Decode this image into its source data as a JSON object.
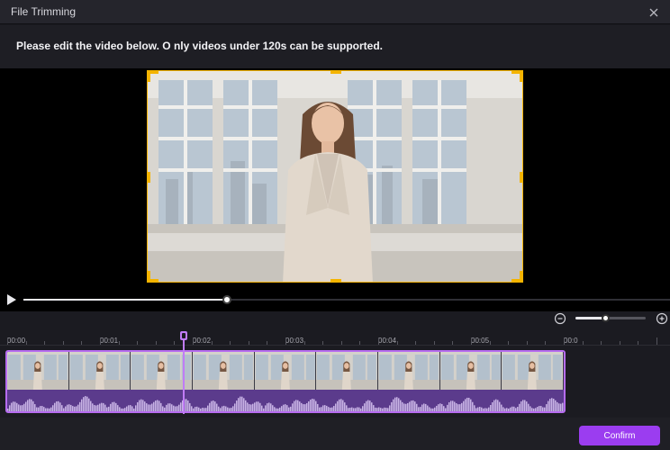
{
  "window": {
    "title": "File Trimming"
  },
  "instruction": {
    "text": "Please edit the video below. O nly videos under 120s can be supported."
  },
  "player": {
    "progress": 0.315
  },
  "zoom": {
    "level": 0.42
  },
  "timeline": {
    "labels": [
      "00:00",
      "00:01",
      "00:02",
      "00:03",
      "00:04",
      "00:05",
      "00:0"
    ],
    "playhead_seconds": 1.9,
    "thumbnail_count": 9
  },
  "footer": {
    "confirm_label": "Confirm"
  },
  "colors": {
    "accent": "#9b3df0",
    "crop_border": "#f4b400",
    "clip_border": "#b66cf0"
  }
}
